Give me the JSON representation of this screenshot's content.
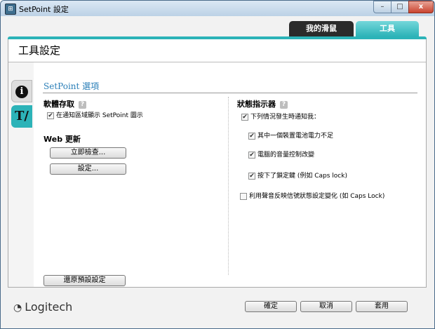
{
  "window": {
    "title": "SetPoint 設定"
  },
  "window_buttons": {
    "minimize": "–",
    "maximize": "□",
    "close": "x"
  },
  "top_tabs": {
    "my_mouse": "我的滑鼠",
    "tools": "工具"
  },
  "page": {
    "title": "工具設定"
  },
  "sidebar": {
    "info_icon": "info-icon",
    "tools_icon": "tools-icon",
    "info_glyph": "i",
    "tools_glyph": "T/"
  },
  "section": {
    "title": "SetPoint 選項"
  },
  "software_access": {
    "title": "軟體存取",
    "help": "?",
    "show_tray_icon": {
      "label": "在通知區域顯示 SetPoint 圖示",
      "checked": true
    }
  },
  "web_update": {
    "title": "Web 更新",
    "check_now": "立即檢查...",
    "settings": "設定..."
  },
  "status_indicator": {
    "title": "狀態指示器",
    "help": "?",
    "notify_when": {
      "label": "下列情況發生時通知我：",
      "checked": true
    },
    "battery_low": {
      "label": "其中一個裝置電池電力不足",
      "checked": true
    },
    "volume_change": {
      "label": "電腦的音量控制改變",
      "checked": true
    },
    "lock_key": {
      "label": "按下了鎖定鍵 (例如 Caps lock)",
      "checked": true
    },
    "sound_feedback": {
      "label": "利用聲音反映信號狀態設定變化 (如 Caps Lock)",
      "checked": false
    }
  },
  "footer": {
    "restore_defaults": "還原預設設定",
    "ok": "確定",
    "cancel": "取消",
    "apply": "套用",
    "logo_text": "Logitech"
  }
}
